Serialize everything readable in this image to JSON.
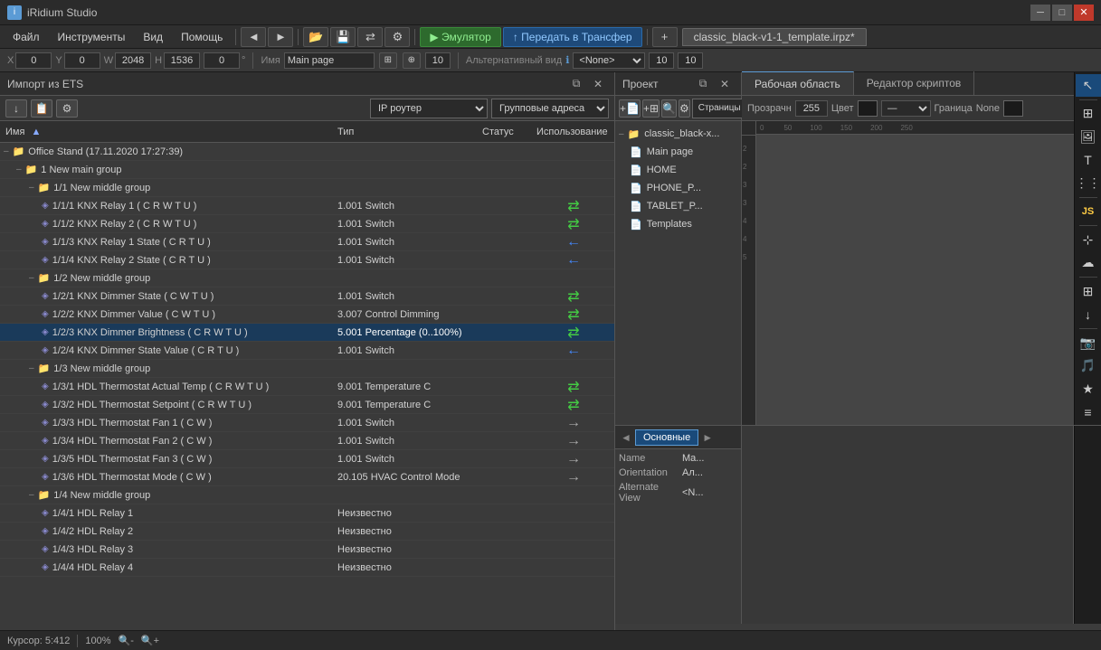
{
  "window": {
    "title": "iRidium Studio"
  },
  "menu": {
    "items": [
      "Файл",
      "Инструменты",
      "Вид",
      "Помощь"
    ]
  },
  "toolbar": {
    "back_label": "◄",
    "forward_label": "►",
    "open_label": "📂",
    "save_label": "💾",
    "transfer_label": "⇄",
    "settings_label": "⚙",
    "emulator_label": "▶ Эмулятор",
    "upload_label": "↑ Передать в Трансфер",
    "plus_label": "+",
    "tab_label": "classic_black-v1-1_template.irpz*"
  },
  "coords_bar": {
    "x_label": "X",
    "x_val": "0",
    "y_label": "Y",
    "y_val": "0",
    "w_label": "W",
    "w_val": "2048",
    "h_label": "H",
    "h_val": "1536",
    "angle_label": "0",
    "name_label": "Имя",
    "name_val": "Main page",
    "alt_view_label": "Альтернативный вид",
    "none_val": "<None>",
    "num1": "10",
    "num2": "10",
    "num3": "10"
  },
  "import_panel": {
    "title": "Импорт из ETS",
    "toolbar_icons": [
      "↓",
      "📋",
      "⚙"
    ],
    "ip_router_label": "IP роутер",
    "group_addr_label": "Групповые адреса",
    "col_name": "Имя",
    "col_type": "Тип",
    "col_status": "Статус",
    "col_usage": "Использование",
    "tree": [
      {
        "level": 0,
        "text": "Office Stand (17.11.2020 17:27:39)",
        "type": "",
        "status": "",
        "usage": "",
        "expand": "–",
        "icon": "folder"
      },
      {
        "level": 1,
        "text": "1 New main group",
        "type": "",
        "status": "",
        "usage": "",
        "expand": "–",
        "icon": "folder"
      },
      {
        "level": 2,
        "text": "1/1 New middle group",
        "type": "",
        "status": "",
        "usage": "",
        "expand": "–",
        "icon": "folder"
      },
      {
        "level": 3,
        "text": "1/1/1 KNX Relay 1 ( C R W T U )",
        "type": "1.001 Switch",
        "status": "",
        "usage": "⇄",
        "expand": "",
        "icon": "item"
      },
      {
        "level": 3,
        "text": "1/1/2 KNX Relay 2 ( C R W T U )",
        "type": "1.001 Switch",
        "status": "",
        "usage": "⇄",
        "expand": "",
        "icon": "item"
      },
      {
        "level": 3,
        "text": "1/1/3 KNX Relay 1 State ( C R T U )",
        "type": "1.001 Switch",
        "status": "",
        "usage": "←",
        "expand": "",
        "icon": "item"
      },
      {
        "level": 3,
        "text": "1/1/4 KNX Relay 2 State ( C R T U )",
        "type": "1.001 Switch",
        "status": "",
        "usage": "←",
        "expand": "",
        "icon": "item"
      },
      {
        "level": 2,
        "text": "1/2 New middle group",
        "type": "",
        "status": "",
        "usage": "",
        "expand": "–",
        "icon": "folder"
      },
      {
        "level": 3,
        "text": "1/2/1 KNX Dimmer State ( C W T U )",
        "type": "1.001 Switch",
        "status": "",
        "usage": "⇄",
        "expand": "",
        "icon": "item"
      },
      {
        "level": 3,
        "text": "1/2/2 KNX Dimmer Value ( C W T U )",
        "type": "3.007 Control Dimming",
        "status": "",
        "usage": "⇄",
        "expand": "",
        "icon": "item"
      },
      {
        "level": 3,
        "text": "1/2/3 KNX Dimmer Brightness ( C R W T U )",
        "type": "5.001 Percentage (0..100%)",
        "status": "",
        "usage": "⇄",
        "expand": "",
        "icon": "item",
        "selected": true
      },
      {
        "level": 3,
        "text": "1/2/4 KNX Dimmer State Value ( C R T U )",
        "type": "1.001 Switch",
        "status": "",
        "usage": "←",
        "expand": "",
        "icon": "item"
      },
      {
        "level": 2,
        "text": "1/3 New middle group",
        "type": "",
        "status": "",
        "usage": "",
        "expand": "–",
        "icon": "folder"
      },
      {
        "level": 3,
        "text": "1/3/1 HDL Thermostat Actual Temp ( C R W T U )",
        "type": "9.001 Temperature C",
        "status": "",
        "usage": "⇄",
        "expand": "",
        "icon": "item"
      },
      {
        "level": 3,
        "text": "1/3/2 HDL Thermostat Setpoint ( C R W T U )",
        "type": "9.001 Temperature C",
        "status": "",
        "usage": "⇄",
        "expand": "",
        "icon": "item"
      },
      {
        "level": 3,
        "text": "1/3/3 HDL Thermostat Fan 1 ( C W )",
        "type": "1.001 Switch",
        "status": "",
        "usage": "→",
        "expand": "",
        "icon": "item"
      },
      {
        "level": 3,
        "text": "1/3/4 HDL Thermostat Fan 2 ( C W )",
        "type": "1.001 Switch",
        "status": "",
        "usage": "→",
        "expand": "",
        "icon": "item"
      },
      {
        "level": 3,
        "text": "1/3/5 HDL Thermostat Fan 3 ( C W )",
        "type": "1.001 Switch",
        "status": "",
        "usage": "→",
        "expand": "",
        "icon": "item"
      },
      {
        "level": 3,
        "text": "1/3/6 HDL Thermostat Mode ( C W )",
        "type": "20.105 HVAC Control Mode",
        "status": "",
        "usage": "→",
        "expand": "",
        "icon": "item"
      },
      {
        "level": 2,
        "text": "1/4 New middle group",
        "type": "",
        "status": "",
        "usage": "",
        "expand": "–",
        "icon": "folder"
      },
      {
        "level": 3,
        "text": "1/4/1 HDL Relay 1",
        "type": "Неизвестно",
        "status": "",
        "usage": "",
        "expand": "",
        "icon": "item"
      },
      {
        "level": 3,
        "text": "1/4/2 HDL Relay 2",
        "type": "Неизвестно",
        "status": "",
        "usage": "",
        "expand": "",
        "icon": "item"
      },
      {
        "level": 3,
        "text": "1/4/3 HDL Relay 3",
        "type": "Неизвестно",
        "status": "",
        "usage": "",
        "expand": "",
        "icon": "item"
      },
      {
        "level": 3,
        "text": "1/4/4 HDL Relay 4",
        "type": "Неизвестно",
        "status": "",
        "usage": "",
        "expand": "",
        "icon": "item"
      }
    ]
  },
  "project_panel": {
    "title": "Проект",
    "pages_label": "Страницы и попапы",
    "tree": [
      {
        "level": 0,
        "text": "classic_black-x...",
        "icon": "folder-yellow",
        "expand": "–"
      },
      {
        "level": 1,
        "text": "Main page",
        "icon": "page"
      },
      {
        "level": 1,
        "text": "HOME",
        "icon": "page"
      },
      {
        "level": 1,
        "text": "PHONE_P...",
        "icon": "page"
      },
      {
        "level": 1,
        "text": "TABLET_P...",
        "icon": "page"
      },
      {
        "level": 1,
        "text": "Templates",
        "icon": "page"
      }
    ]
  },
  "work_area": {
    "tab_work": "Рабочая область",
    "tab_scripts": "Редактор скриптов",
    "transparency_label": "Прозрачн",
    "transparency_val": "255",
    "color_label": "Цвет",
    "border_label": "Граница",
    "border_val": "None",
    "ruler_marks": [
      "0",
      "50",
      "100",
      "150",
      "200",
      "250"
    ]
  },
  "properties": {
    "tab_main": "Основные",
    "rows": [
      {
        "key": "Name",
        "val": "Ma..."
      },
      {
        "key": "Orientation",
        "val": "Ал..."
      },
      {
        "key": "Alternate View",
        "val": "<N..."
      }
    ]
  },
  "status_bar": {
    "cursor": "Курсор: 5:412",
    "zoom": "100%"
  },
  "right_toolbar_icons": [
    "⊹",
    "T",
    "⋮⋮",
    "⊞",
    "☷",
    "↓",
    "☁"
  ],
  "side_icons": [
    "↕",
    "⊞",
    "☷",
    "📷",
    "⊞",
    "✎",
    "♪",
    "★",
    "≡"
  ]
}
